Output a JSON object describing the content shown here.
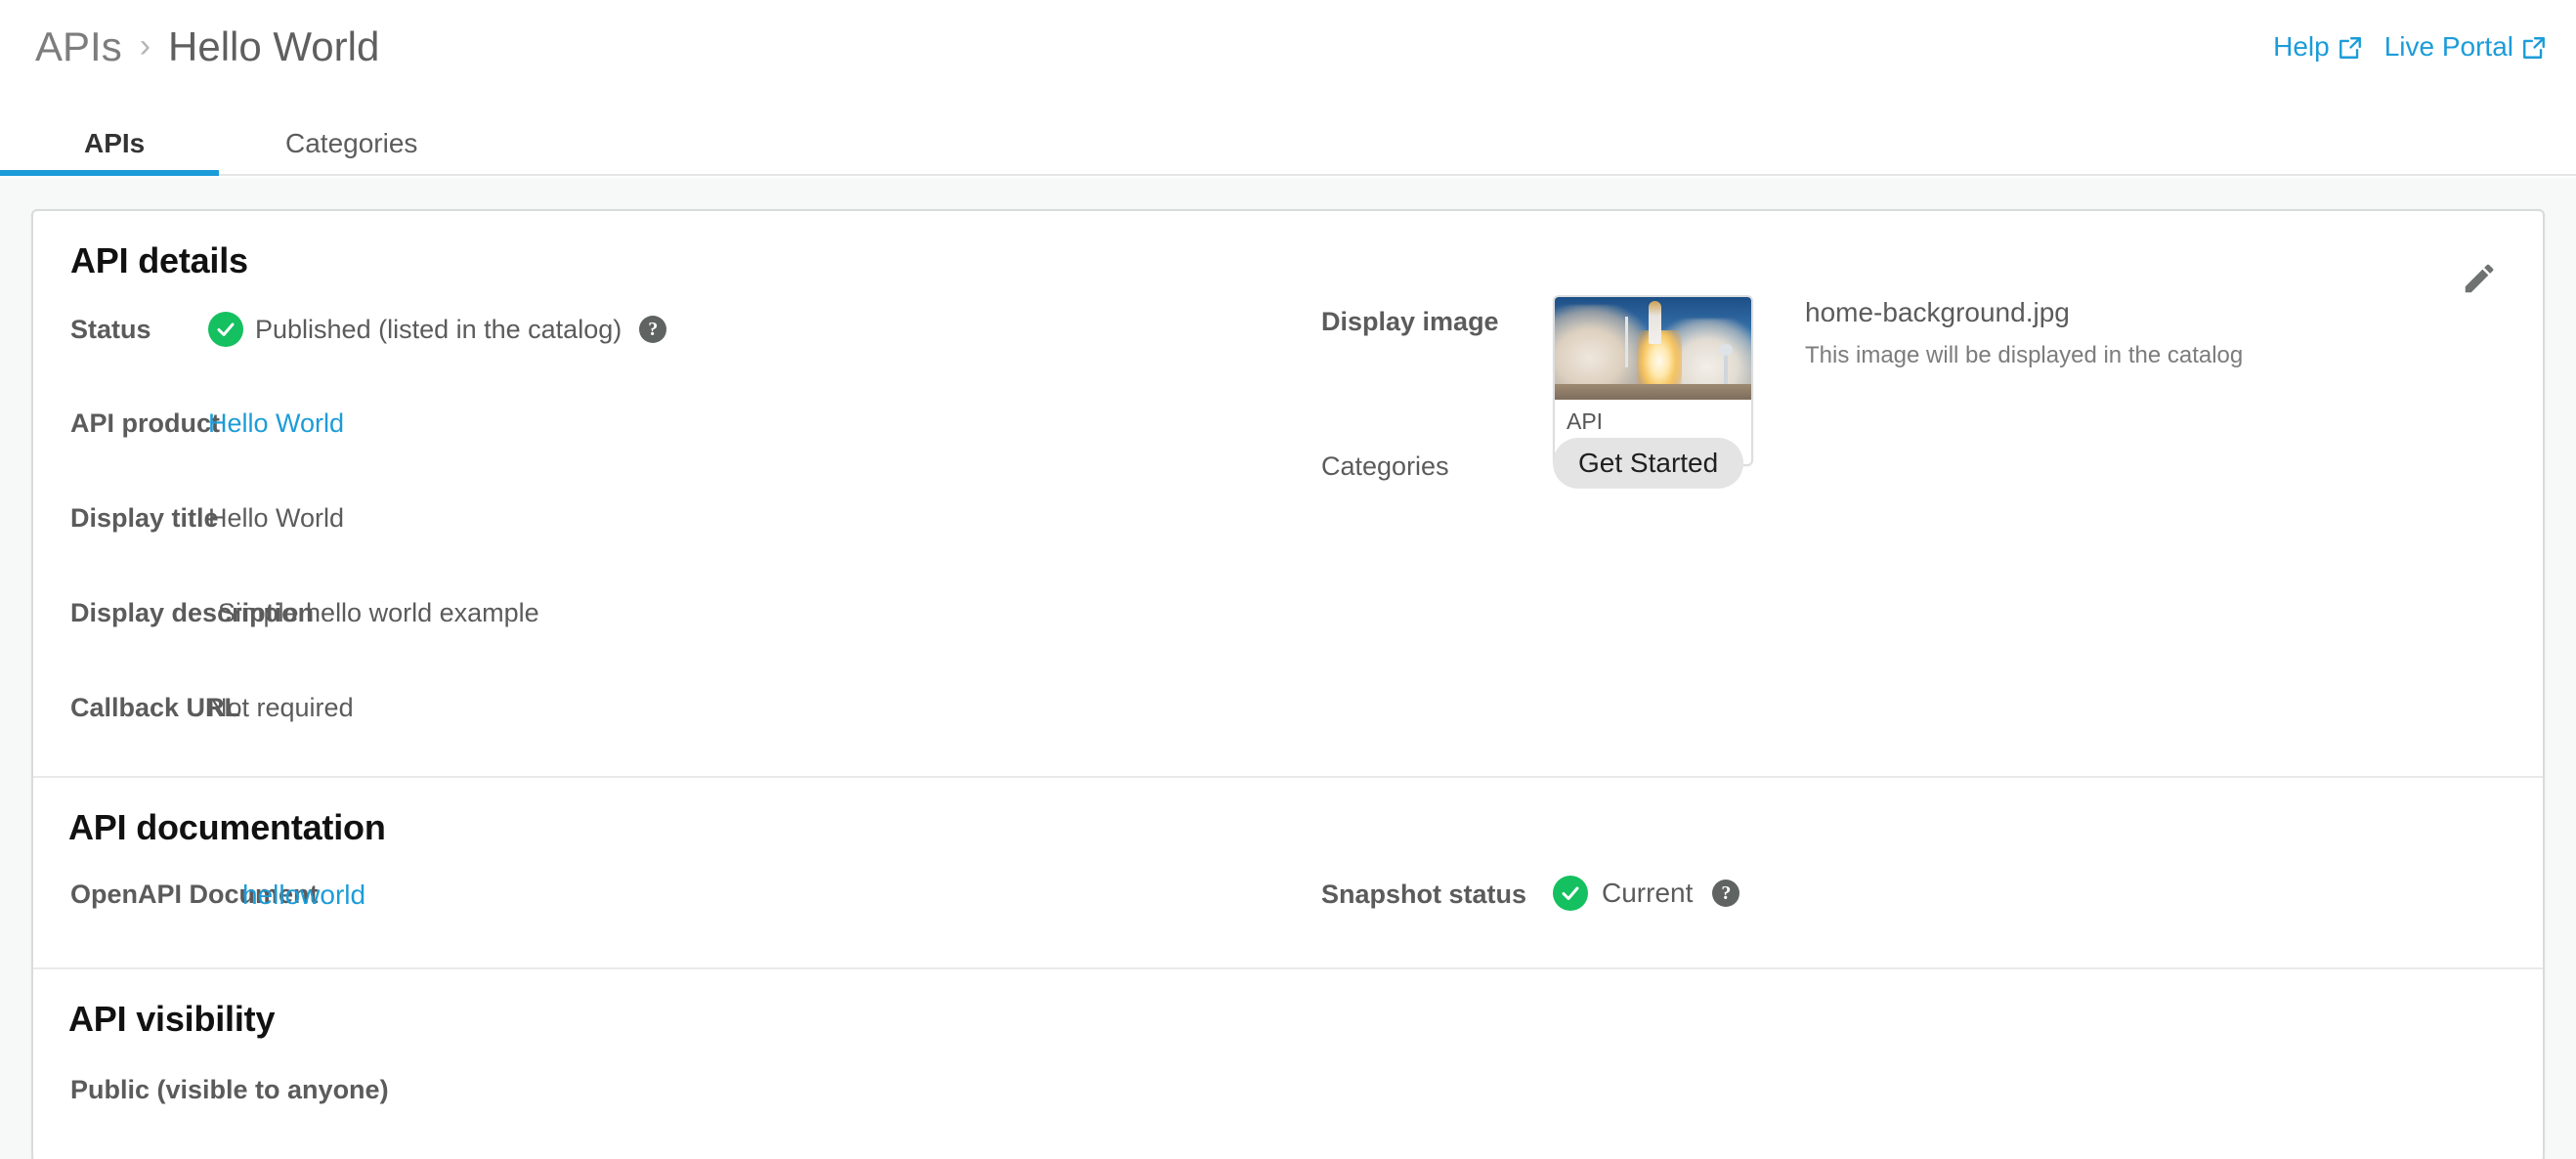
{
  "breadcrumb": {
    "root": "APIs",
    "separator": "›",
    "current": "Hello World"
  },
  "header_links": [
    {
      "label": "Help",
      "icon": "external-link-icon"
    },
    {
      "label": "Live Portal",
      "icon": "external-link-icon"
    }
  ],
  "tabs": [
    {
      "label": "APIs",
      "active": true
    },
    {
      "label": "Categories",
      "active": false
    }
  ],
  "api_details": {
    "section_title": "API details",
    "edit_icon": "pencil-icon",
    "rows": {
      "status": {
        "label": "Status",
        "value": "Published (listed in the catalog)",
        "icon": "check-circle-icon",
        "help": "?"
      },
      "api_product": {
        "label": "API product",
        "value": "Hello World"
      },
      "display_title": {
        "label": "Display title",
        "value": "Hello World"
      },
      "display_description": {
        "label": "Display description",
        "value": "Simple hello world example"
      },
      "callback_url": {
        "label": "Callback URL",
        "value": "Not required"
      }
    },
    "display_image": {
      "label": "Display image",
      "thumbnail_title": "API",
      "file_name": "home-background.jpg",
      "note": "This image will be displayed in the catalog"
    },
    "categories": {
      "label": "Categories",
      "chips": [
        "Get Started"
      ]
    }
  },
  "api_documentation": {
    "section_title": "API documentation",
    "openapi": {
      "label": "OpenAPI Document",
      "value": "helloworld"
    },
    "snapshot": {
      "label": "Snapshot status",
      "value": "Current",
      "icon": "check-circle-icon",
      "help": "?"
    }
  },
  "api_visibility": {
    "section_title": "API visibility",
    "value": "Public (visible to anyone)"
  },
  "colors": {
    "link": "#1c9cd8",
    "success": "#14c05f",
    "label": "#5b5b5b",
    "page_bg": "#f7f8f8",
    "card_border": "#d8dadb"
  }
}
